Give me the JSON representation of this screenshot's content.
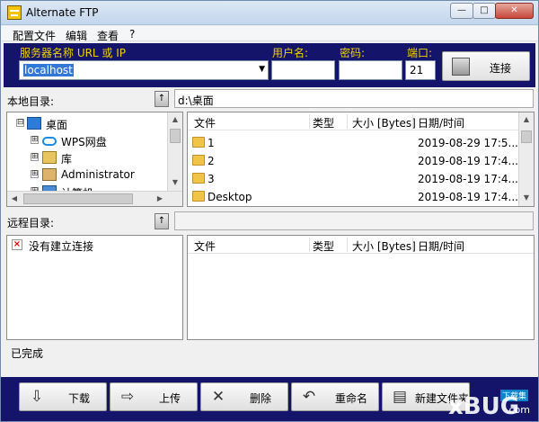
{
  "window": {
    "title": "Alternate FTP",
    "controls": {
      "minimize": "—",
      "maximize": "□",
      "close": "✕"
    }
  },
  "menu": [
    "配置文件",
    "编辑",
    "查看",
    "?"
  ],
  "connection": {
    "host_label": "服务器名称 URL 或 IP",
    "host_value": "localhost",
    "user_label": "用户名:",
    "user_value": "",
    "password_label": "密码:",
    "password_value": "",
    "port_label": "端口:",
    "port_value": "21",
    "connect_label": "连接"
  },
  "local": {
    "label": "本地目录:",
    "path": "d:\\桌面",
    "tree": [
      {
        "label": "桌面",
        "expander": "⊟",
        "icon": "desktop-icon"
      },
      {
        "label": "WPS网盘",
        "expander": "⊞",
        "icon": "cloud-icon"
      },
      {
        "label": "库",
        "expander": "⊞",
        "icon": "library-icon"
      },
      {
        "label": "Administrator",
        "expander": "⊞",
        "icon": "user-folder-icon"
      },
      {
        "label": "计算机",
        "expander": "⊞",
        "icon": "computer-icon"
      }
    ],
    "columns": [
      "文件",
      "类型",
      "大小 [Bytes]",
      "日期/时间"
    ],
    "files": [
      {
        "name": "1",
        "date": "2019-08-29 17:5..."
      },
      {
        "name": "2",
        "date": "2019-08-19 17:4..."
      },
      {
        "name": "3",
        "date": "2019-08-19 17:4..."
      },
      {
        "name": "Desktop",
        "date": "2019-08-19 17:4..."
      }
    ]
  },
  "remote": {
    "label": "远程目录:",
    "path": "",
    "tree_message": "没有建立连接",
    "columns": [
      "文件",
      "类型",
      "大小 [Bytes]",
      "日期/时间"
    ]
  },
  "status": "已完成",
  "actions": [
    {
      "label": "下载",
      "icon": "download-icon",
      "glyph": "⇩"
    },
    {
      "label": "上传",
      "icon": "upload-icon",
      "glyph": "⇨"
    },
    {
      "label": "删除",
      "icon": "delete-icon",
      "glyph": "✕"
    },
    {
      "label": "重命名",
      "icon": "rename-icon",
      "glyph": "↶"
    },
    {
      "label": "新建文件夹",
      "icon": "new-folder-icon",
      "glyph": "▤"
    }
  ],
  "watermark": {
    "small": "下载集",
    "big": "xBUG",
    "suffix": ".com"
  },
  "colors": {
    "panel": "#14146a",
    "label": "#f2d200",
    "selection": "#3378d6"
  }
}
